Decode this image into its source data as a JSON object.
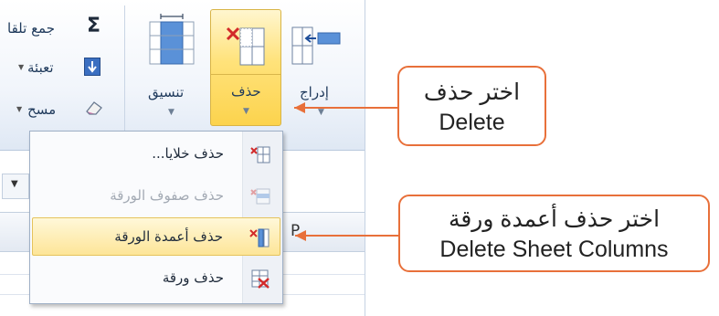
{
  "ribbon": {
    "autosum_label": "جمع تلقا",
    "fill_label": "تعبئة",
    "clear_label": "مسح",
    "format_label": "تنسيق",
    "delete_label": "حذف",
    "insert_label": "إدراج",
    "partial_col_letter": "P"
  },
  "menu": {
    "items": [
      {
        "label": "حذف خلايا...",
        "state": "normal"
      },
      {
        "label": "حذف صفوف الورقة",
        "state": "disabled"
      },
      {
        "label": "حذف أعمدة الورقة",
        "state": "highlighted"
      },
      {
        "label": "حذف ورقة",
        "state": "normal"
      }
    ]
  },
  "callouts": {
    "delete": {
      "ar": "اختر حذف",
      "en": "Delete"
    },
    "delete_columns": {
      "ar": "اختر حذف أعمدة ورقة",
      "en": "Delete Sheet Columns"
    }
  },
  "colors": {
    "callout_border": "#e8703a",
    "arrow": "#e8703a",
    "highlight": "#fde598",
    "ribbon_text": "#1e395b"
  }
}
